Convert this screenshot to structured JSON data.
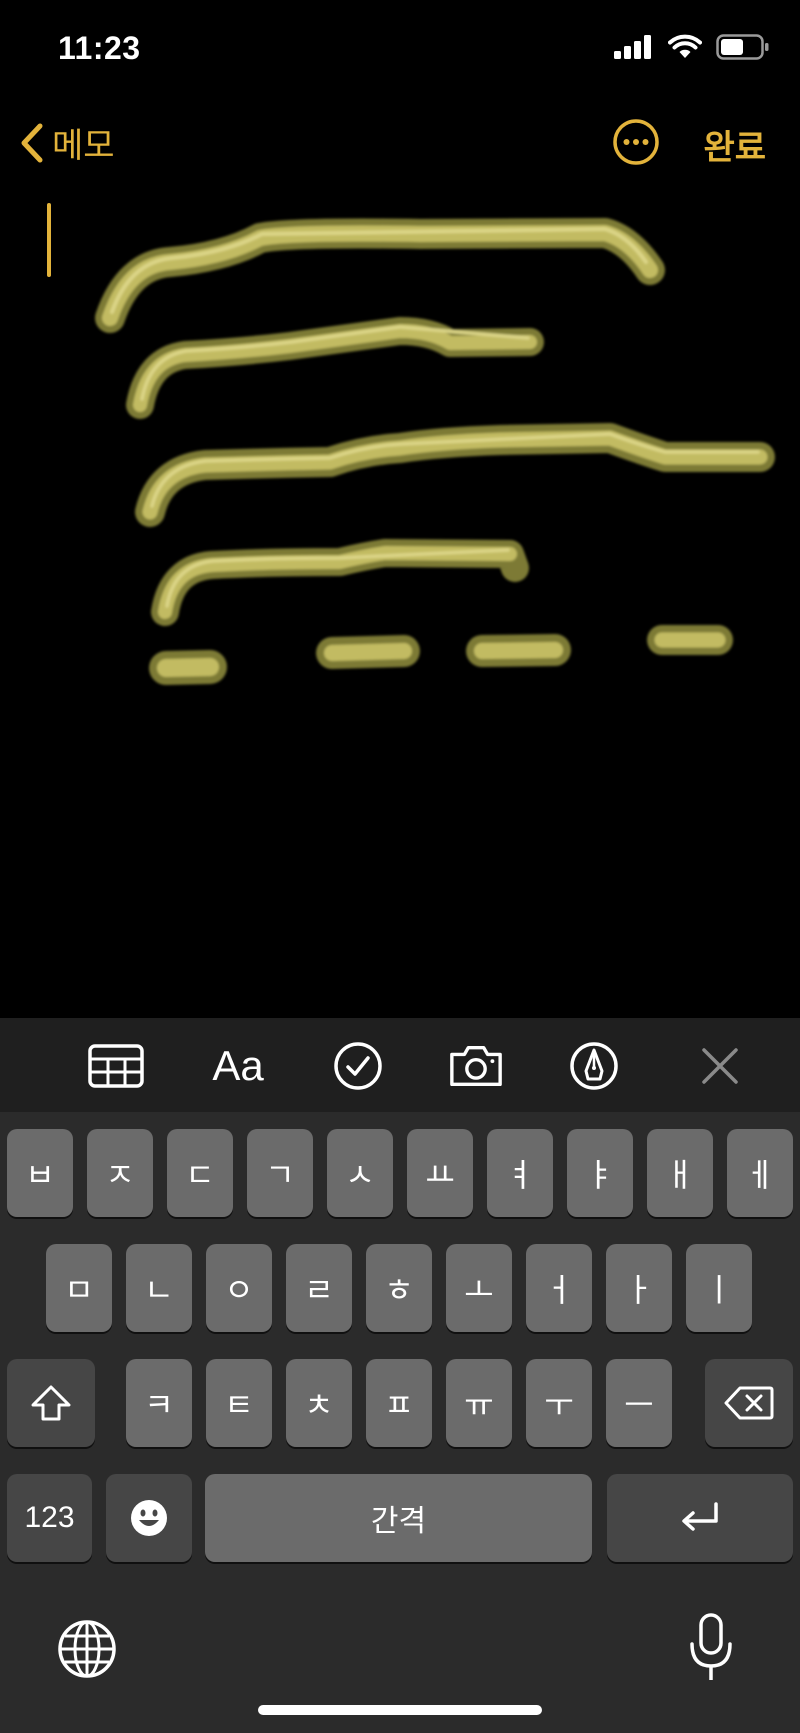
{
  "status": {
    "time": "11:23"
  },
  "nav": {
    "back_label": "메모",
    "done_label": "완료"
  },
  "toolbar": {
    "format_label": "Aa"
  },
  "keyboard": {
    "row1": [
      "ㅂ",
      "ㅈ",
      "ㄷ",
      "ㄱ",
      "ㅅ",
      "ㅛ",
      "ㅕ",
      "ㅑ",
      "ㅐ",
      "ㅔ"
    ],
    "row2": [
      "ㅁ",
      "ㄴ",
      "ㅇ",
      "ㄹ",
      "ㅎ",
      "ㅗ",
      "ㅓ",
      "ㅏ",
      "ㅣ"
    ],
    "row3": [
      "ㅋ",
      "ㅌ",
      "ㅊ",
      "ㅍ",
      "ㅠ",
      "ㅜ",
      "ㅡ"
    ],
    "numbers_label": "123",
    "space_label": "간격"
  },
  "colors": {
    "accent": "#E3B33B",
    "ink": "#B9B35A",
    "keyboard_bg": "#2b2b2b",
    "key_bg": "#6b6b6b"
  },
  "icons": {
    "table": "table-icon",
    "checklist": "checkmark-circle-icon",
    "camera": "camera-icon",
    "markup": "pen-tip-circle-icon",
    "close": "close-icon",
    "shift": "shift-arrow-icon",
    "delete": "backspace-icon",
    "emoji": "emoji-icon",
    "return": "return-arrow-icon",
    "globe": "globe-icon",
    "mic": "microphone-icon"
  }
}
